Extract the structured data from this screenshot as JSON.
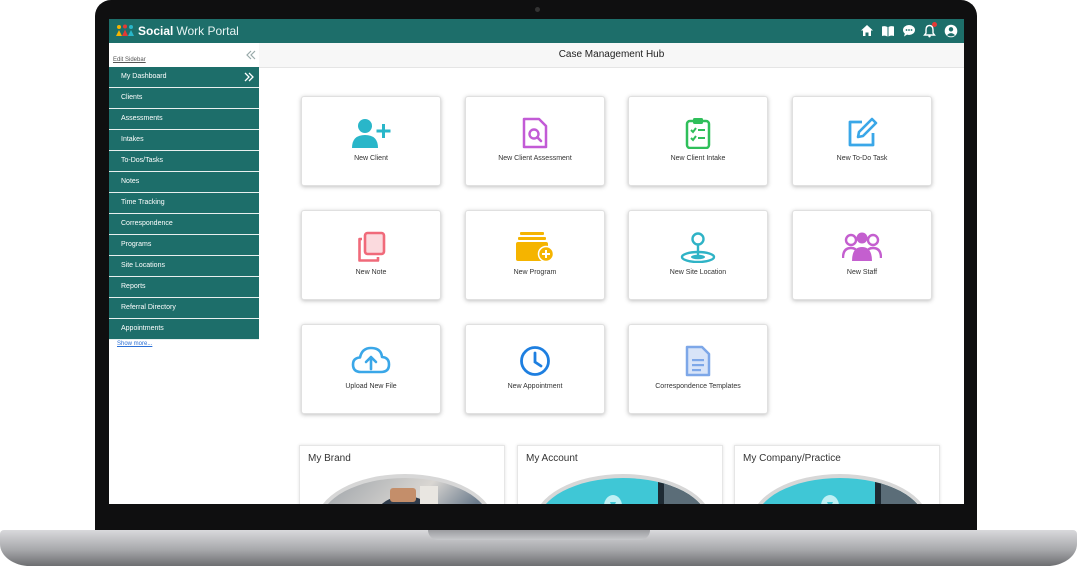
{
  "app": {
    "brand_bold": "Social",
    "brand_rest": "Work Portal"
  },
  "topbar": {
    "icons": [
      "home-icon",
      "book-icon",
      "chat-icon",
      "bell-icon",
      "user-icon"
    ]
  },
  "sidebar": {
    "edit_label": "Edit Sidebar",
    "show_more": "Show more...",
    "items": [
      {
        "label": "My Dashboard"
      },
      {
        "label": "Clients"
      },
      {
        "label": "Assessments"
      },
      {
        "label": "Intakes"
      },
      {
        "label": "To-Dos/Tasks"
      },
      {
        "label": "Notes"
      },
      {
        "label": "Time Tracking"
      },
      {
        "label": "Correspondence"
      },
      {
        "label": "Programs"
      },
      {
        "label": "Site Locations"
      },
      {
        "label": "Reports"
      },
      {
        "label": "Referral Directory"
      },
      {
        "label": "Appointments"
      }
    ]
  },
  "hub": {
    "title": "Case Management Hub",
    "tiles": [
      {
        "label": "New Client",
        "icon": "add-user-icon",
        "color": "#29b6c9"
      },
      {
        "label": "New Client Assessment",
        "icon": "document-search-icon",
        "color": "#c25bd6"
      },
      {
        "label": "New Client Intake",
        "icon": "clipboard-check-icon",
        "color": "#2fbf5a"
      },
      {
        "label": "New To-Do Task",
        "icon": "edit-icon",
        "color": "#3aa7e8"
      },
      {
        "label": "New Note",
        "icon": "notes-icon",
        "color": "#f06a7a"
      },
      {
        "label": "New Program",
        "icon": "folder-add-icon",
        "color": "#f5b400"
      },
      {
        "label": "New Site Location",
        "icon": "location-pin-icon",
        "color": "#2fb3c6"
      },
      {
        "label": "New Staff",
        "icon": "group-icon",
        "color": "#c45fcf"
      },
      {
        "label": "Upload New File",
        "icon": "cloud-upload-icon",
        "color": "#3aa7e8"
      },
      {
        "label": "New Appointment",
        "icon": "clock-icon",
        "color": "#1e7fe0"
      },
      {
        "label": "Correspondence Templates",
        "icon": "document-icon",
        "color": "#7da7e8"
      }
    ]
  },
  "cards": [
    {
      "title": "My Brand"
    },
    {
      "title": "My Account"
    },
    {
      "title": "My Company/Practice"
    }
  ],
  "colors": {
    "primary": "#1d6e6a",
    "link": "#2a6fd6"
  }
}
